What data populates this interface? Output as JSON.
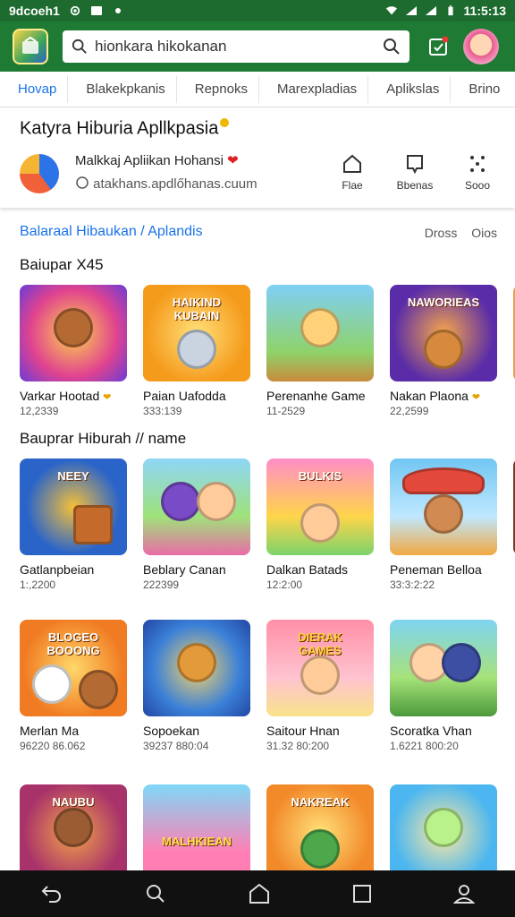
{
  "status_bar": {
    "left_text": "9dcoeh1",
    "time": "11:5:13"
  },
  "search": {
    "value": "hionkara hikokanan"
  },
  "tabs": [
    {
      "label": "Hovap",
      "active": true
    },
    {
      "label": "Blakekpkanis",
      "active": false
    },
    {
      "label": "Repnoks",
      "active": false
    },
    {
      "label": "Marexpladias",
      "active": false
    },
    {
      "label": "Aplikslas",
      "active": false
    },
    {
      "label": "Brino",
      "active": false
    }
  ],
  "card": {
    "title": "Katyra Hiburia Apllkpasia",
    "developer": "Malkkaj Apliikan Hohansi",
    "url": "atakhans.apdlőhanas.cuum",
    "actions": [
      {
        "label": "Flae"
      },
      {
        "label": "Bbenas"
      },
      {
        "label": "Sooo"
      }
    ]
  },
  "section": {
    "link": "Balaraal Hibaukan / Aplandis",
    "right": "Dross Oios"
  },
  "rows": [
    {
      "title": "Baiupar X45",
      "apps": [
        {
          "name": "Varkar Hootad",
          "num": "12,2339",
          "heart": true
        },
        {
          "name": "Paian Uafodda",
          "num": "333:139",
          "heart": false
        },
        {
          "name": "Perenanhe Game",
          "num": "11-2529",
          "heart": false
        },
        {
          "name": "Nakan Plaona",
          "num": "22,2599",
          "heart": true
        }
      ]
    },
    {
      "title": "Bauprar Hiburah // name",
      "apps": [
        {
          "name": "Gatlanpbeian",
          "num": "1:,2200",
          "heart": false
        },
        {
          "name": "Beblary Canan",
          "num": "222399",
          "heart": false
        },
        {
          "name": "Dalkan Batads",
          "num": "12:2:00",
          "heart": false
        },
        {
          "name": "Peneman Belloa",
          "num": "33:3:2:22",
          "heart": false
        }
      ]
    },
    {
      "title": "",
      "apps": [
        {
          "name": "Merlan Ma",
          "num": "96220 86.062",
          "heart": false
        },
        {
          "name": "Sopoekan",
          "num": "39237 880:04",
          "heart": false
        },
        {
          "name": "Saitour Hnan",
          "num": "31.32 80:200",
          "heart": false
        },
        {
          "name": "Scoratka Vhan",
          "num": "1.6221 800:20",
          "heart": false
        }
      ]
    },
    {
      "title": "",
      "apps": [
        {
          "name": "",
          "num": "",
          "heart": false
        },
        {
          "name": "",
          "num": "",
          "heart": false
        },
        {
          "name": "",
          "num": "",
          "heart": false
        },
        {
          "name": "",
          "num": "",
          "heart": false
        }
      ]
    }
  ],
  "thumb_banners": {
    "r0a1": "HAIKIND KUBAIN",
    "r0a3": "NAWORIEAS",
    "r1a0": "NEEY",
    "r1a2": "BULKIS",
    "r2a0": "BLOGEO BOOONG",
    "r2a2": "DIERAK GAMES",
    "r3a0": "NAUBU",
    "r3a1": "MALHKIEAN",
    "r3a2": "NAKREAK"
  },
  "colors": {
    "header": "#1f7a34",
    "status": "#1d6b2e",
    "accent": "#1a73e8"
  }
}
